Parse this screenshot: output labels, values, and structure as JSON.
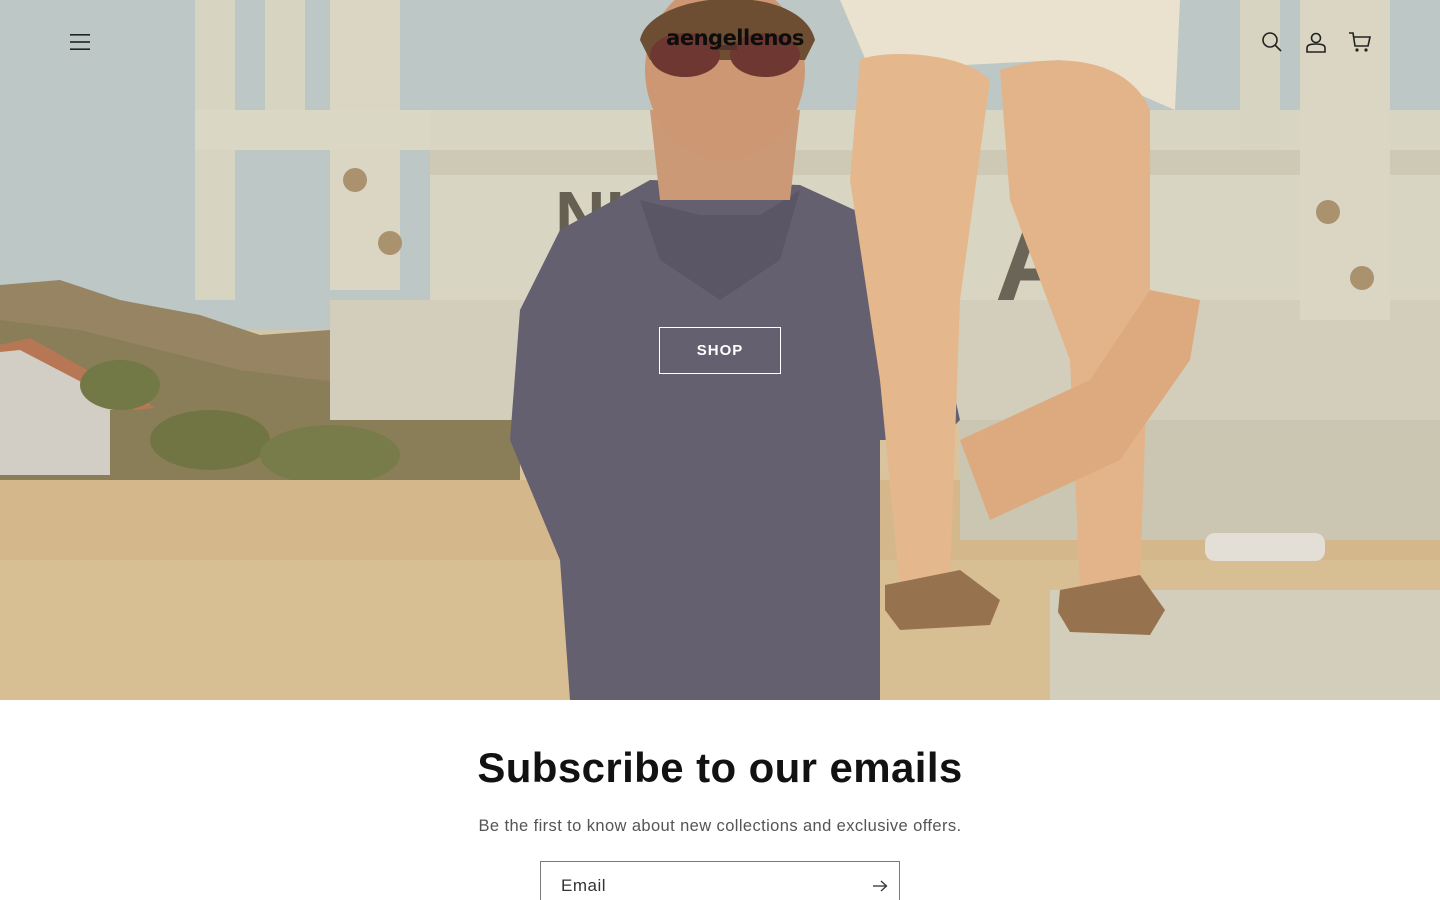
{
  "header": {
    "logo_text": "aengellenos",
    "menu_icon": "hamburger-menu-icon",
    "search_icon": "search-icon",
    "account_icon": "account-icon",
    "cart_icon": "cart-icon"
  },
  "hero": {
    "shop_label": "SHOP",
    "image_description_icon": "hero-photo"
  },
  "newsletter": {
    "title": "Subscribe to our emails",
    "subtitle": "Be the first to know about new collections and exclusive offers.",
    "email_placeholder": "Email",
    "submit_icon": "arrow-right-icon"
  },
  "colors": {
    "text": "#121212",
    "muted": "#555555",
    "border": "#7a7a7a",
    "button_border": "#ffffff"
  }
}
